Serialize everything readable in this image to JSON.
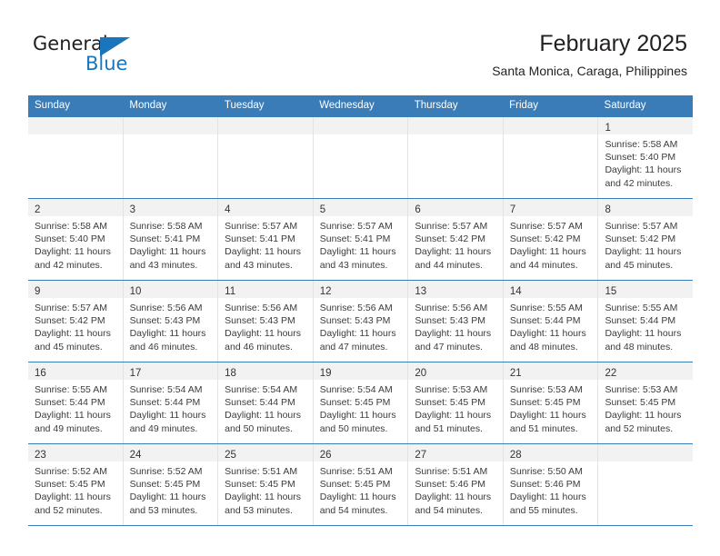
{
  "brand": {
    "name_part1": "General",
    "name_part2": "Blue",
    "accent_color": "#1b75bb"
  },
  "header": {
    "title": "February 2025",
    "subtitle": "Santa Monica, Caraga, Philippines"
  },
  "calendar": {
    "header_color": "#3a7cb8",
    "weekdays": [
      "Sunday",
      "Monday",
      "Tuesday",
      "Wednesday",
      "Thursday",
      "Friday",
      "Saturday"
    ],
    "weeks": [
      [
        {
          "day": "",
          "sunrise": "",
          "sunset": "",
          "daylight": ""
        },
        {
          "day": "",
          "sunrise": "",
          "sunset": "",
          "daylight": ""
        },
        {
          "day": "",
          "sunrise": "",
          "sunset": "",
          "daylight": ""
        },
        {
          "day": "",
          "sunrise": "",
          "sunset": "",
          "daylight": ""
        },
        {
          "day": "",
          "sunrise": "",
          "sunset": "",
          "daylight": ""
        },
        {
          "day": "",
          "sunrise": "",
          "sunset": "",
          "daylight": ""
        },
        {
          "day": "1",
          "sunrise": "Sunrise: 5:58 AM",
          "sunset": "Sunset: 5:40 PM",
          "daylight": "Daylight: 11 hours and 42 minutes."
        }
      ],
      [
        {
          "day": "2",
          "sunrise": "Sunrise: 5:58 AM",
          "sunset": "Sunset: 5:40 PM",
          "daylight": "Daylight: 11 hours and 42 minutes."
        },
        {
          "day": "3",
          "sunrise": "Sunrise: 5:58 AM",
          "sunset": "Sunset: 5:41 PM",
          "daylight": "Daylight: 11 hours and 43 minutes."
        },
        {
          "day": "4",
          "sunrise": "Sunrise: 5:57 AM",
          "sunset": "Sunset: 5:41 PM",
          "daylight": "Daylight: 11 hours and 43 minutes."
        },
        {
          "day": "5",
          "sunrise": "Sunrise: 5:57 AM",
          "sunset": "Sunset: 5:41 PM",
          "daylight": "Daylight: 11 hours and 43 minutes."
        },
        {
          "day": "6",
          "sunrise": "Sunrise: 5:57 AM",
          "sunset": "Sunset: 5:42 PM",
          "daylight": "Daylight: 11 hours and 44 minutes."
        },
        {
          "day": "7",
          "sunrise": "Sunrise: 5:57 AM",
          "sunset": "Sunset: 5:42 PM",
          "daylight": "Daylight: 11 hours and 44 minutes."
        },
        {
          "day": "8",
          "sunrise": "Sunrise: 5:57 AM",
          "sunset": "Sunset: 5:42 PM",
          "daylight": "Daylight: 11 hours and 45 minutes."
        }
      ],
      [
        {
          "day": "9",
          "sunrise": "Sunrise: 5:57 AM",
          "sunset": "Sunset: 5:42 PM",
          "daylight": "Daylight: 11 hours and 45 minutes."
        },
        {
          "day": "10",
          "sunrise": "Sunrise: 5:56 AM",
          "sunset": "Sunset: 5:43 PM",
          "daylight": "Daylight: 11 hours and 46 minutes."
        },
        {
          "day": "11",
          "sunrise": "Sunrise: 5:56 AM",
          "sunset": "Sunset: 5:43 PM",
          "daylight": "Daylight: 11 hours and 46 minutes."
        },
        {
          "day": "12",
          "sunrise": "Sunrise: 5:56 AM",
          "sunset": "Sunset: 5:43 PM",
          "daylight": "Daylight: 11 hours and 47 minutes."
        },
        {
          "day": "13",
          "sunrise": "Sunrise: 5:56 AM",
          "sunset": "Sunset: 5:43 PM",
          "daylight": "Daylight: 11 hours and 47 minutes."
        },
        {
          "day": "14",
          "sunrise": "Sunrise: 5:55 AM",
          "sunset": "Sunset: 5:44 PM",
          "daylight": "Daylight: 11 hours and 48 minutes."
        },
        {
          "day": "15",
          "sunrise": "Sunrise: 5:55 AM",
          "sunset": "Sunset: 5:44 PM",
          "daylight": "Daylight: 11 hours and 48 minutes."
        }
      ],
      [
        {
          "day": "16",
          "sunrise": "Sunrise: 5:55 AM",
          "sunset": "Sunset: 5:44 PM",
          "daylight": "Daylight: 11 hours and 49 minutes."
        },
        {
          "day": "17",
          "sunrise": "Sunrise: 5:54 AM",
          "sunset": "Sunset: 5:44 PM",
          "daylight": "Daylight: 11 hours and 49 minutes."
        },
        {
          "day": "18",
          "sunrise": "Sunrise: 5:54 AM",
          "sunset": "Sunset: 5:44 PM",
          "daylight": "Daylight: 11 hours and 50 minutes."
        },
        {
          "day": "19",
          "sunrise": "Sunrise: 5:54 AM",
          "sunset": "Sunset: 5:45 PM",
          "daylight": "Daylight: 11 hours and 50 minutes."
        },
        {
          "day": "20",
          "sunrise": "Sunrise: 5:53 AM",
          "sunset": "Sunset: 5:45 PM",
          "daylight": "Daylight: 11 hours and 51 minutes."
        },
        {
          "day": "21",
          "sunrise": "Sunrise: 5:53 AM",
          "sunset": "Sunset: 5:45 PM",
          "daylight": "Daylight: 11 hours and 51 minutes."
        },
        {
          "day": "22",
          "sunrise": "Sunrise: 5:53 AM",
          "sunset": "Sunset: 5:45 PM",
          "daylight": "Daylight: 11 hours and 52 minutes."
        }
      ],
      [
        {
          "day": "23",
          "sunrise": "Sunrise: 5:52 AM",
          "sunset": "Sunset: 5:45 PM",
          "daylight": "Daylight: 11 hours and 52 minutes."
        },
        {
          "day": "24",
          "sunrise": "Sunrise: 5:52 AM",
          "sunset": "Sunset: 5:45 PM",
          "daylight": "Daylight: 11 hours and 53 minutes."
        },
        {
          "day": "25",
          "sunrise": "Sunrise: 5:51 AM",
          "sunset": "Sunset: 5:45 PM",
          "daylight": "Daylight: 11 hours and 53 minutes."
        },
        {
          "day": "26",
          "sunrise": "Sunrise: 5:51 AM",
          "sunset": "Sunset: 5:45 PM",
          "daylight": "Daylight: 11 hours and 54 minutes."
        },
        {
          "day": "27",
          "sunrise": "Sunrise: 5:51 AM",
          "sunset": "Sunset: 5:46 PM",
          "daylight": "Daylight: 11 hours and 54 minutes."
        },
        {
          "day": "28",
          "sunrise": "Sunrise: 5:50 AM",
          "sunset": "Sunset: 5:46 PM",
          "daylight": "Daylight: 11 hours and 55 minutes."
        },
        {
          "day": "",
          "sunrise": "",
          "sunset": "",
          "daylight": ""
        }
      ]
    ]
  }
}
